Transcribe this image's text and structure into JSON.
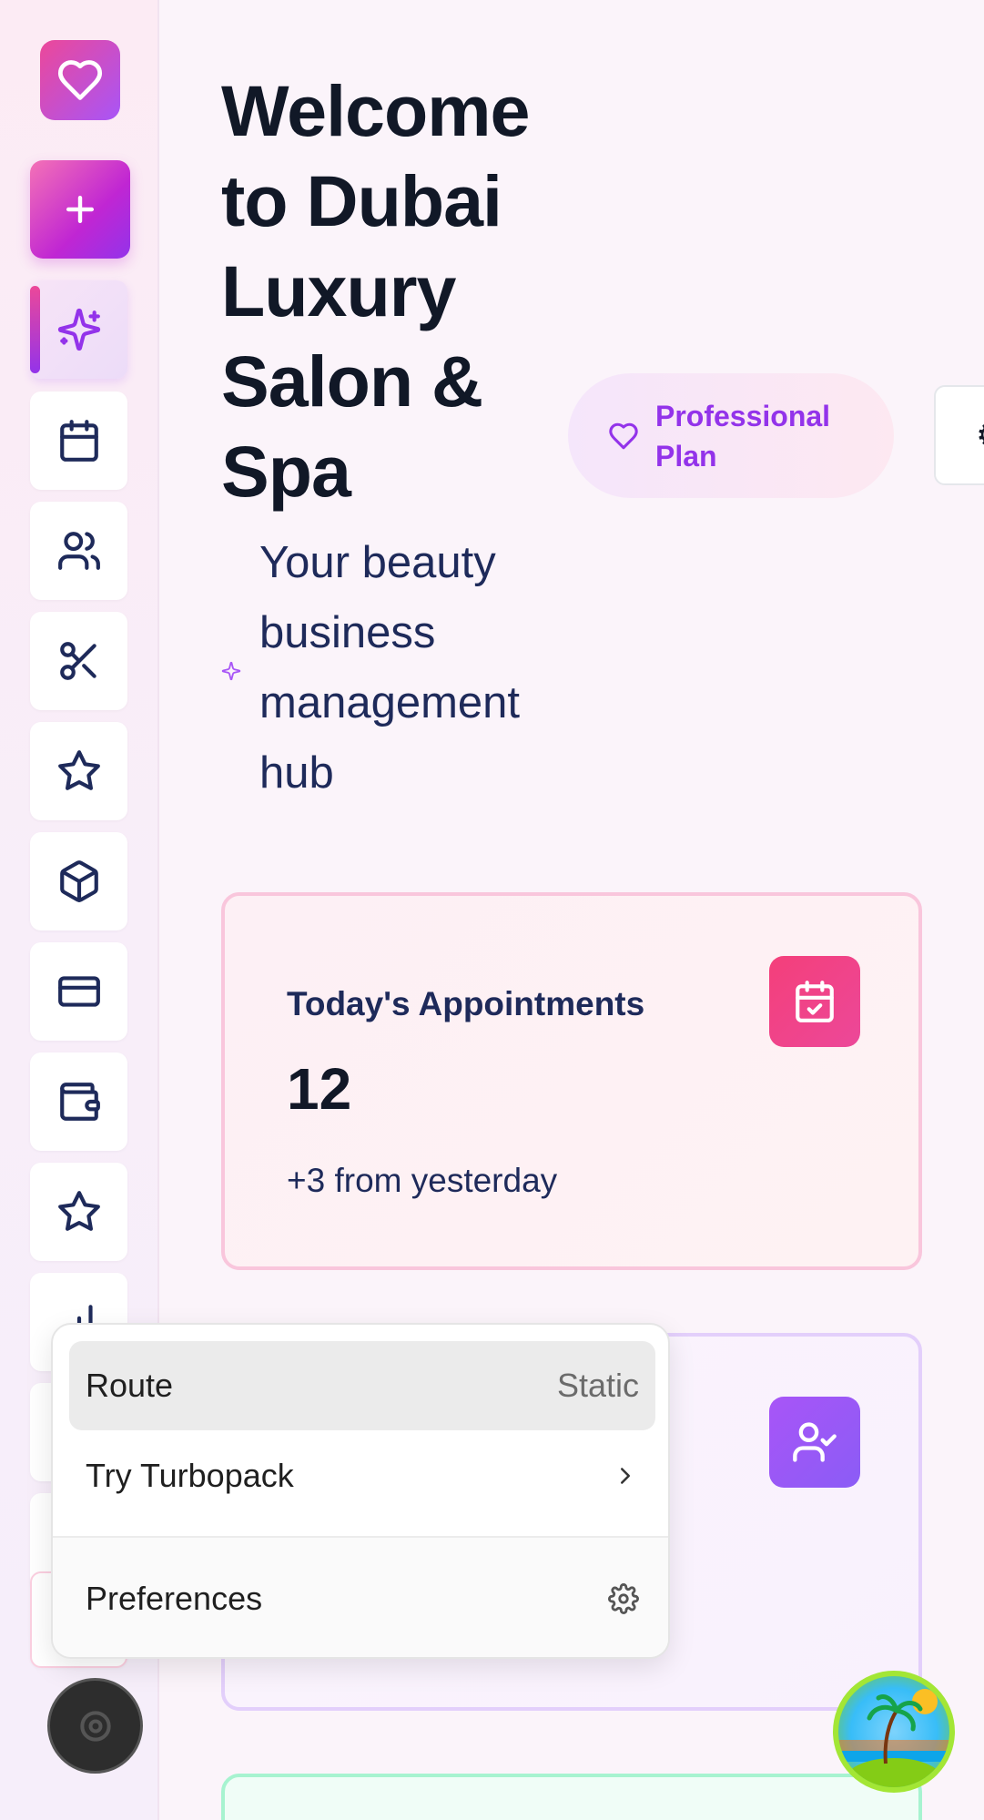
{
  "sidebar": {
    "logo_icon": "heart-icon",
    "add_icon": "plus-icon",
    "items": [
      {
        "name": "sparkles",
        "icon": "sparkles-icon",
        "active": true
      },
      {
        "name": "calendar",
        "icon": "calendar-icon"
      },
      {
        "name": "clients",
        "icon": "users-icon"
      },
      {
        "name": "services",
        "icon": "scissors-icon"
      },
      {
        "name": "reviews",
        "icon": "star-icon"
      },
      {
        "name": "inventory",
        "icon": "box-icon"
      },
      {
        "name": "payments",
        "icon": "credit-card-icon"
      },
      {
        "name": "wallet",
        "icon": "wallet-icon"
      },
      {
        "name": "favorites",
        "icon": "star-icon"
      },
      {
        "name": "analytics",
        "icon": "bar-chart-icon"
      }
    ]
  },
  "header": {
    "title": "Welcome to Dubai Luxury Salon & Spa",
    "plan_badge": "Professional Plan",
    "subtitle": "Your beauty business management hub"
  },
  "cards": [
    {
      "label": "Today's Appointments",
      "value": "12",
      "sub": "+3 from yesterday",
      "icon": "calendar-check-icon"
    },
    {
      "label": "",
      "value": "",
      "sub": "",
      "icon": "user-check-icon"
    }
  ],
  "devtools_menu": {
    "route_label": "Route",
    "route_value": "Static",
    "turbopack_label": "Try Turbopack",
    "preferences_label": "Preferences"
  },
  "colors": {
    "accent_pink": "#ec4899",
    "accent_purple": "#9333ea",
    "text_dark": "#111827",
    "text_navy": "#1e2a5a"
  }
}
